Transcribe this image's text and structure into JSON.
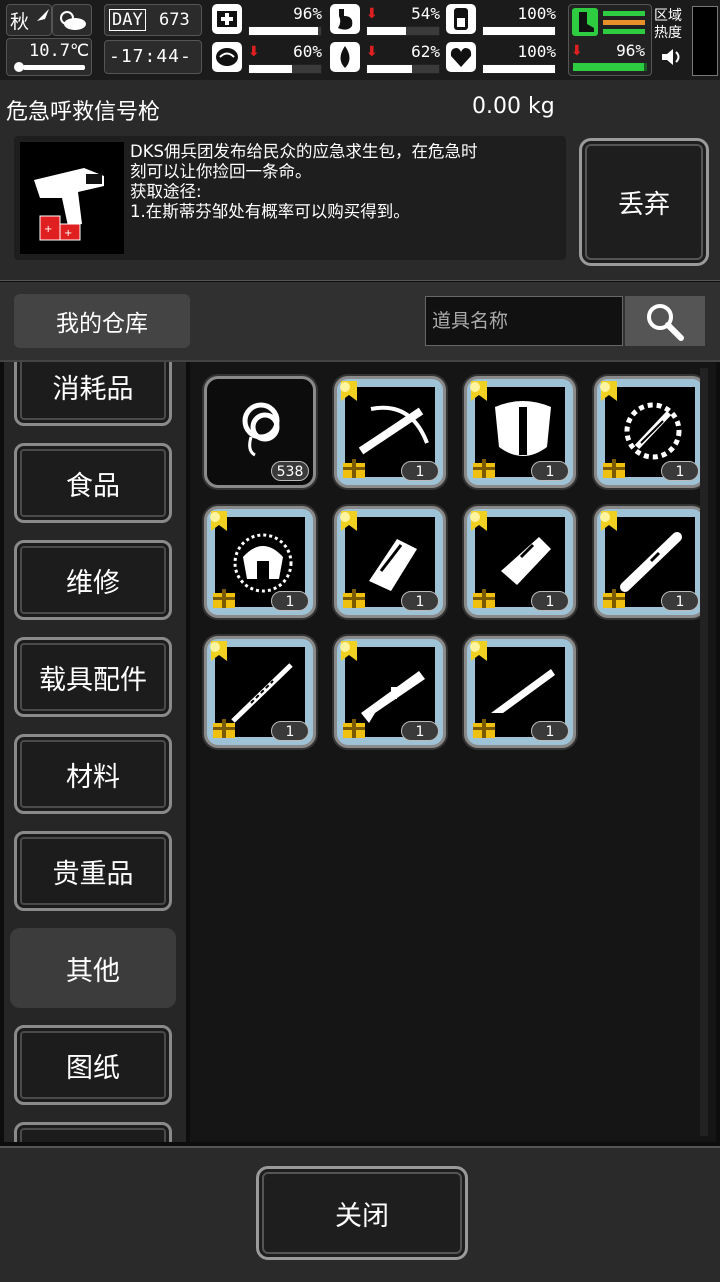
{
  "status": {
    "season": "秋",
    "day_label": "DAY",
    "day_number": "673",
    "temperature": "10.7℃",
    "time": "-17:44-",
    "stats": [
      {
        "name": "health",
        "value": "96%",
        "level": 0.96,
        "icon": "medkit-icon",
        "arrow": false
      },
      {
        "name": "hunger",
        "value": "54%",
        "level": 0.54,
        "icon": "stomach-icon",
        "arrow": true
      },
      {
        "name": "energy",
        "value": "100%",
        "level": 1.0,
        "icon": "battery-icon",
        "arrow": false
      },
      {
        "name": "mental",
        "value": "60%",
        "level": 0.6,
        "icon": "brain-icon",
        "arrow": true
      },
      {
        "name": "thirst",
        "value": "62%",
        "level": 0.62,
        "icon": "water-drop-icon",
        "arrow": true
      },
      {
        "name": "mood",
        "value": "100%",
        "level": 1.0,
        "icon": "heart-icon",
        "arrow": false
      }
    ],
    "stamina_value": "96%",
    "stamina_level": 0.96,
    "zone_heat_label": "区域热度",
    "colors": {
      "accent_green": "#2ecc40",
      "warning_red": "#e02020",
      "orange": "#e8902a"
    }
  },
  "item": {
    "name": "危急呼救信号枪",
    "weight": "0.00 kg",
    "description_lines": [
      "DKS佣兵团发布给民众的应急求生包，在危急时",
      "刻可以让你捡回一条命。",
      "获取途径:",
      "1.在斯蒂芬邹处有概率可以购买得到。"
    ],
    "icon": "flare-gun-icon",
    "discard_label": "丢弃"
  },
  "warehouse": {
    "title": "我的仓库",
    "search_placeholder": "道具名称",
    "search_icon": "search-icon"
  },
  "categories": [
    {
      "label": "消耗品",
      "active": false
    },
    {
      "label": "食品",
      "active": false
    },
    {
      "label": "维修",
      "active": false
    },
    {
      "label": "载具配件",
      "active": false
    },
    {
      "label": "材料",
      "active": false
    },
    {
      "label": "贵重品",
      "active": false
    },
    {
      "label": "其他",
      "active": true
    },
    {
      "label": "图纸",
      "active": false
    }
  ],
  "items": [
    {
      "icon": "rope-icon",
      "count": "538",
      "rare": false
    },
    {
      "icon": "crossbow-icon",
      "count": "1",
      "rare": true
    },
    {
      "icon": "skull-mask-icon",
      "count": "1",
      "rare": true
    },
    {
      "icon": "blade-emblem-icon",
      "count": "1",
      "rare": true
    },
    {
      "icon": "armored-helmet-icon",
      "count": "1",
      "rare": true
    },
    {
      "icon": "gauntlet-icon",
      "count": "1",
      "rare": true
    },
    {
      "icon": "drill-icon",
      "count": "1",
      "rare": true
    },
    {
      "icon": "pipe-icon",
      "count": "1",
      "rare": true
    },
    {
      "icon": "spear-icon",
      "count": "1",
      "rare": true
    },
    {
      "icon": "shotgun-icon",
      "count": "1",
      "rare": true
    },
    {
      "icon": "rifle-icon",
      "count": "1",
      "rare": true
    }
  ],
  "footer": {
    "close_label": "关闭"
  }
}
